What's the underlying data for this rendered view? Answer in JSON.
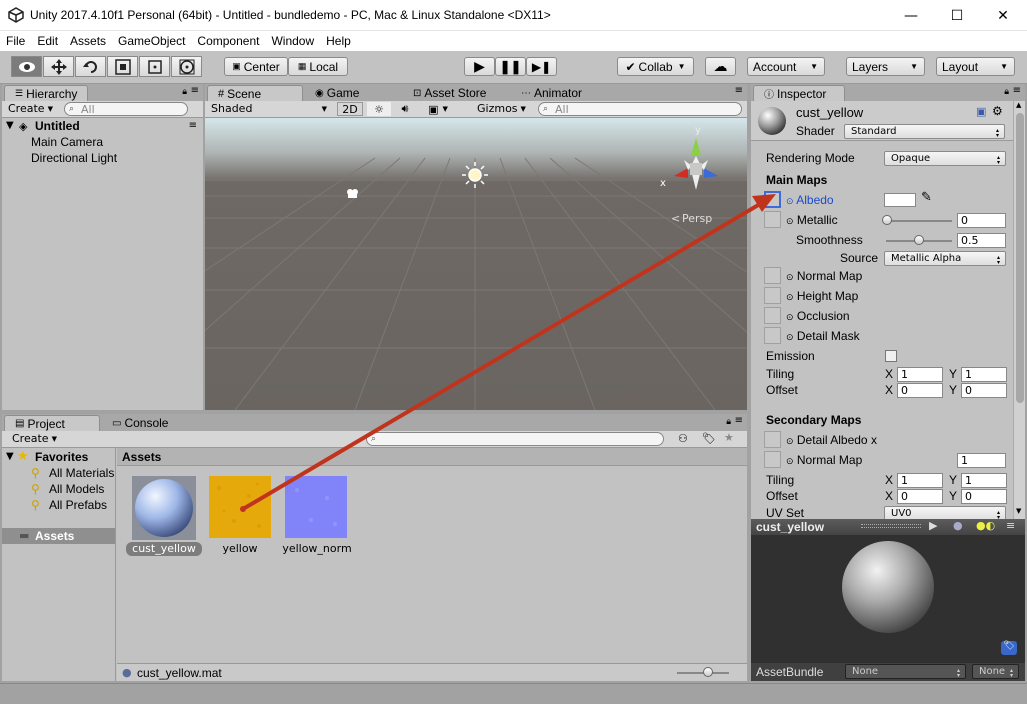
{
  "window": {
    "title": "Unity 2017.4.10f1 Personal (64bit) - Untitled - bundledemo - PC, Mac & Linux Standalone <DX11>",
    "controls": [
      "—",
      "☐",
      "✕"
    ]
  },
  "menu": [
    "File",
    "Edit",
    "Assets",
    "GameObject",
    "Component",
    "Window",
    "Help"
  ],
  "toolbar": {
    "pivot": "Center",
    "space": "Local",
    "collab": "Collab",
    "account": "Account",
    "layers": "Layers",
    "layout": "Layout"
  },
  "hierarchy": {
    "tab": "Hierarchy",
    "create": "Create",
    "search_placeholder": "All",
    "scene": "Untitled",
    "items": [
      "Main Camera",
      "Directional Light"
    ]
  },
  "scene_tabs": [
    "Scene",
    "Game",
    "Asset Store",
    "Animator"
  ],
  "scene_toolbar": {
    "shading": "Shaded",
    "mode2d": "2D",
    "gizmos": "Gizmos",
    "search_placeholder": "All"
  },
  "gizmo": {
    "y": "y",
    "x": "x",
    "persp": "Persp"
  },
  "project": {
    "tabs": [
      "Project",
      "Console"
    ],
    "create": "Create",
    "favorites": "Favorites",
    "favorite_items": [
      "All Materials",
      "All Models",
      "All Prefabs"
    ],
    "assets_folder": "Assets",
    "breadcrumb": "Assets",
    "assets": [
      {
        "name": "cust_yellow",
        "kind": "material"
      },
      {
        "name": "yellow",
        "kind": "texture-yellow"
      },
      {
        "name": "yellow_norm",
        "kind": "texture-normal"
      }
    ],
    "status_file": "cust_yellow.mat"
  },
  "inspector": {
    "tab": "Inspector",
    "name": "cust_yellow",
    "shader_label": "Shader",
    "shader": "Standard",
    "rendering_mode_label": "Rendering Mode",
    "rendering_mode": "Opaque",
    "main_maps": "Main Maps",
    "albedo": "Albedo",
    "metallic": "Metallic",
    "metallic_value": "0",
    "smoothness": "Smoothness",
    "smoothness_value": "0.5",
    "source_label": "Source",
    "source": "Metallic Alpha",
    "normal_map": "Normal Map",
    "height_map": "Height Map",
    "occlusion": "Occlusion",
    "detail_mask": "Detail Mask",
    "emission": "Emission",
    "tiling": "Tiling",
    "offset": "Offset",
    "x": "X",
    "y": "Y",
    "tiling_x": "1",
    "tiling_y": "1",
    "offset_x": "0",
    "offset_y": "0",
    "secondary_maps": "Secondary Maps",
    "detail_albedo": "Detail Albedo x",
    "normal_map2": "Normal Map",
    "normal_map2_value": "1",
    "tiling2_x": "1",
    "tiling2_y": "1",
    "offset2_x": "0",
    "offset2_y": "0",
    "uv_set_label": "UV Set",
    "uv_set": "UV0",
    "preview_name": "cust_yellow",
    "assetbundle_label": "AssetBundle",
    "assetbundle": "None",
    "assetbundle_variant": "None",
    "metallic_level": 0.0,
    "smoothness_level": 0.5
  },
  "colors": {
    "arrow": "#c0341d",
    "yellow_texture": "#e8ad0a",
    "normal_texture": "#8080ff",
    "scene_ground": "#6b6560",
    "scene_sky": "#d4e4e9"
  }
}
